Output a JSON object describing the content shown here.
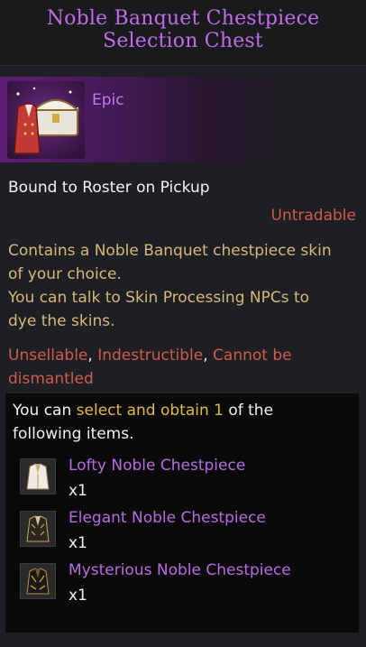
{
  "title": "Noble Banquet Chestpiece Selection Chest",
  "grade": "Epic",
  "bound": "Bound to Roster on Pickup",
  "trade": "Untradable",
  "description": [
    "Contains a Noble Banquet chestpiece skin",
    "of your choice.",
    "You can talk to Skin Processing NPCs to",
    "dye the skins."
  ],
  "flags": {
    "unsellable": "Unsellable",
    "indestructible": "Indestructible",
    "cannot_dismantle_1": "Cannot be",
    "cannot_dismantle_2": "dismantled",
    "sep": ", "
  },
  "selection": {
    "prefix": "You can ",
    "highlight": "select and obtain 1",
    "suffix_1": " of the",
    "suffix_2": "following items."
  },
  "items": [
    {
      "name": "Lofty Noble Chestpiece",
      "qty": "x1",
      "icon": "white-gold-coat-icon"
    },
    {
      "name": "Elegant Noble Chestpiece",
      "qty": "x1",
      "icon": "black-gold-coat-icon"
    },
    {
      "name": "Mysterious Noble Chestpiece",
      "qty": "x1",
      "icon": "dark-gold-coat-icon"
    }
  ],
  "colors": {
    "title": "#c06bea",
    "epic": "#c878ee",
    "warning": "#d25a4f",
    "description": "#d6b87a",
    "highlight": "#e3b94a",
    "item_name": "#b86be0"
  }
}
